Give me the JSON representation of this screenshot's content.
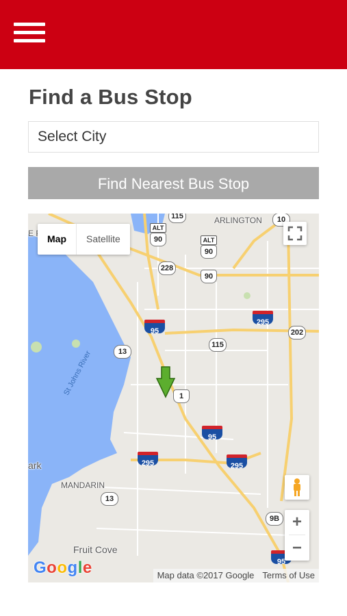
{
  "header": {
    "menu_icon": "hamburger-menu-icon",
    "background_color": "#cc0012"
  },
  "main": {
    "title": "Find a Bus Stop",
    "city_select": {
      "selected_value": "Select City"
    },
    "find_button_label": "Find Nearest Bus Stop",
    "find_button_color": "#a9a9a9"
  },
  "map": {
    "type_control": {
      "map_label": "Map",
      "satellite_label": "Satellite"
    },
    "place_labels": {
      "arlington": "ARLINGTON",
      "mandarin": "MANDARIN",
      "fruit_cove": "Fruit Cove",
      "park": "ark",
      "river": "St Johns River",
      "left_edge": "E P"
    },
    "route_shields": {
      "r10": "10",
      "r228": "228",
      "r90a": "90",
      "r90b": "90",
      "r90c": "90",
      "r95a": "95",
      "r95b": "95",
      "r95c": "95",
      "r115": "115",
      "r202": "202",
      "r295a": "295",
      "r295b": "295",
      "r295c": "295",
      "r13a": "13",
      "r13b": "13",
      "r1": "1",
      "r9b": "9B",
      "r115top": "115",
      "alt_a": "ALT",
      "alt_b": "ALT"
    },
    "google_logo": "Google",
    "attribution": "Map data ©2017 Google",
    "terms_label": "Terms of Use",
    "zoom_in": "+",
    "zoom_out": "−",
    "marker_icon": "bus-stop-marker-icon",
    "marker_color": "#5cae2e"
  }
}
